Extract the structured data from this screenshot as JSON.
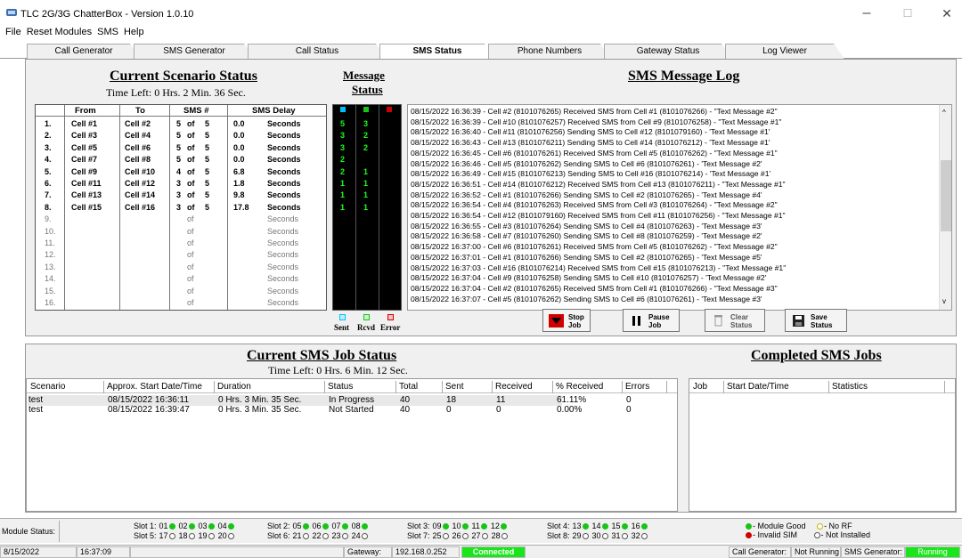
{
  "window": {
    "title": "TLC 2G/3G ChatterBox - Version 1.0.10",
    "min": "–",
    "max": "☐",
    "close": "✕"
  },
  "menu": [
    "File",
    "Reset Modules",
    "SMS",
    "Help"
  ],
  "tabs": [
    "Call Generator",
    "SMS Generator",
    "Call Status",
    "SMS Status",
    "Phone Numbers",
    "Gateway Status",
    "Log Viewer"
  ],
  "scenario": {
    "title": "Current Scenario Status",
    "time_left": "Time Left: 0 Hrs. 2 Min. 36 Sec.",
    "headers": [
      "From",
      "To",
      "SMS #",
      "SMS Delay"
    ],
    "rows": [
      {
        "n": "1.",
        "from": "Cell #1",
        "to": "Cell #2",
        "a": "5",
        "of": "of",
        "b": "5",
        "delay": "0.0",
        "unit": "Seconds"
      },
      {
        "n": "2.",
        "from": "Cell #3",
        "to": "Cell #4",
        "a": "5",
        "of": "of",
        "b": "5",
        "delay": "0.0",
        "unit": "Seconds"
      },
      {
        "n": "3.",
        "from": "Cell #5",
        "to": "Cell #6",
        "a": "5",
        "of": "of",
        "b": "5",
        "delay": "0.0",
        "unit": "Seconds"
      },
      {
        "n": "4.",
        "from": "Cell #7",
        "to": "Cell #8",
        "a": "5",
        "of": "of",
        "b": "5",
        "delay": "0.0",
        "unit": "Seconds"
      },
      {
        "n": "5.",
        "from": "Cell #9",
        "to": "Cell #10",
        "a": "4",
        "of": "of",
        "b": "5",
        "delay": "6.8",
        "unit": "Seconds"
      },
      {
        "n": "6.",
        "from": "Cell #11",
        "to": "Cell #12",
        "a": "3",
        "of": "of",
        "b": "5",
        "delay": "1.8",
        "unit": "Seconds"
      },
      {
        "n": "7.",
        "from": "Cell #13",
        "to": "Cell #14",
        "a": "3",
        "of": "of",
        "b": "5",
        "delay": "9.8",
        "unit": "Seconds"
      },
      {
        "n": "8.",
        "from": "Cell #15",
        "to": "Cell #16",
        "a": "3",
        "of": "of",
        "b": "5",
        "delay": "17.8",
        "unit": "Seconds"
      },
      {
        "n": "9.",
        "from": "",
        "to": "",
        "a": "",
        "of": "of",
        "b": "",
        "delay": "",
        "unit": "Seconds"
      },
      {
        "n": "10.",
        "from": "",
        "to": "",
        "a": "",
        "of": "of",
        "b": "",
        "delay": "",
        "unit": "Seconds"
      },
      {
        "n": "11.",
        "from": "",
        "to": "",
        "a": "",
        "of": "of",
        "b": "",
        "delay": "",
        "unit": "Seconds"
      },
      {
        "n": "12.",
        "from": "",
        "to": "",
        "a": "",
        "of": "of",
        "b": "",
        "delay": "",
        "unit": "Seconds"
      },
      {
        "n": "13.",
        "from": "",
        "to": "",
        "a": "",
        "of": "of",
        "b": "",
        "delay": "",
        "unit": "Seconds"
      },
      {
        "n": "14.",
        "from": "",
        "to": "",
        "a": "",
        "of": "of",
        "b": "",
        "delay": "",
        "unit": "Seconds"
      },
      {
        "n": "15.",
        "from": "",
        "to": "",
        "a": "",
        "of": "of",
        "b": "",
        "delay": "",
        "unit": "Seconds"
      },
      {
        "n": "16.",
        "from": "",
        "to": "",
        "a": "",
        "of": "of",
        "b": "",
        "delay": "",
        "unit": "Seconds"
      }
    ]
  },
  "message_status": {
    "title_1": "Message",
    "title_2": "Status",
    "rows": [
      [
        "5",
        "3"
      ],
      [
        "3",
        "2"
      ],
      [
        "3",
        "2"
      ],
      [
        "2",
        ""
      ],
      [
        "2",
        "1"
      ],
      [
        "1",
        "1"
      ],
      [
        "1",
        "1"
      ],
      [
        "1",
        "1"
      ]
    ],
    "legend": [
      "Sent",
      "Rcvd",
      "Error"
    ],
    "colors": {
      "sent": "#00bfff",
      "rcvd": "#19c419",
      "error": "#d10000"
    }
  },
  "log": {
    "title": "SMS Message Log",
    "lines": [
      "08/15/2022 16:36:39 - Cell #2 (8101076265) Received SMS from Cell #1 (8101076266) - \"Text Message #2\"",
      "08/15/2022 16:36:39 - Cell #10 (8101076257) Received SMS from Cell #9 (8101076258) - \"Text Message #1\"",
      "08/15/2022 16:36:40 - Cell #11 (8101076256) Sending SMS to Cell #12 (8101079160) - 'Text Message #1'",
      "08/15/2022 16:36:43 - Cell #13 (8101076211) Sending SMS to Cell #14 (8101076212) - 'Text Message #1'",
      "08/15/2022 16:36:45 - Cell #6 (8101076261) Received SMS from Cell #5 (8101076262) - \"Text Message #1\"",
      "08/15/2022 16:36:46 - Cell #5 (8101076262) Sending SMS to Cell #6 (8101076261) - 'Text Message #2'",
      "08/15/2022 16:36:49 - Cell #15 (8101076213) Sending SMS to Cell #16 (8101076214) - 'Text Message #1'",
      "08/15/2022 16:36:51 - Cell #14 (8101076212) Received SMS from Cell #13 (8101076211) - \"Text Message #1\"",
      "08/15/2022 16:36:52 - Cell #1 (8101076266) Sending SMS to Cell #2 (8101076265) - 'Text Message #4'",
      "08/15/2022 16:36:54 - Cell #4 (8101076263) Received SMS from Cell #3 (8101076264) - \"Text Message #2\"",
      "08/15/2022 16:36:54 - Cell #12 (8101079160) Received SMS from Cell #11 (8101076256) - \"Text Message #1\"",
      "08/15/2022 16:36:55 - Cell #3 (8101076264) Sending SMS to Cell #4 (8101076263) - 'Text Message #3'",
      "08/15/2022 16:36:58 - Cell #7 (8101076260) Sending SMS to Cell #8 (8101076259) - 'Text Message #2'",
      "08/15/2022 16:37:00 - Cell #6 (8101076261) Received SMS from Cell #5 (8101076262) - \"Text Message #2\"",
      "08/15/2022 16:37:01 - Cell #1 (8101076266) Sending SMS to Cell #2 (8101076265) - 'Text Message #5'",
      "08/15/2022 16:37:03 - Cell #16 (8101076214) Received SMS from Cell #15 (8101076213) - \"Text Message #1\"",
      "08/15/2022 16:37:04 - Cell #9 (8101076258) Sending SMS to Cell #10 (8101076257) - 'Text Message #2'",
      "08/15/2022 16:37:04 - Cell #2 (8101076265) Received SMS from Cell #1 (8101076266) - \"Text Message #3\"",
      "08/15/2022 16:37:07 - Cell #5 (8101076262) Sending SMS to Cell #6 (8101076261) - 'Text Message #3'"
    ]
  },
  "buttons": {
    "stop": "Stop",
    "pause": "Pause",
    "clear": "Clear",
    "save": "Save",
    "job": "Job",
    "status": "Status"
  },
  "job_status": {
    "title": "Current SMS Job Status",
    "time_left": "Time Left: 0 Hrs. 6 Min. 12 Sec.",
    "headers": [
      "Scenario",
      "Approx. Start Date/Time",
      "Duration",
      "Status",
      "Total",
      "Sent",
      "Received",
      "% Received",
      "Errors"
    ],
    "rows": [
      [
        "test",
        "08/15/2022 16:36:11",
        "0 Hrs. 3 Min. 35 Sec.",
        "In Progress",
        "40",
        "18",
        "11",
        "61.11%",
        "0"
      ],
      [
        "test",
        "08/15/2022 16:39:47",
        "0 Hrs. 3 Min. 35 Sec.",
        "Not Started",
        "40",
        "0",
        "0",
        "0.00%",
        "0"
      ]
    ]
  },
  "completed": {
    "title": "Completed SMS Jobs",
    "headers": [
      "Job",
      "Start Date/Time",
      "Statistics"
    ]
  },
  "module_status": {
    "label": "Module Status:",
    "slots": [
      {
        "name": "Slot 1:",
        "mods": [
          "01",
          "02",
          "03",
          "04"
        ],
        "state": "good"
      },
      {
        "name": "Slot 5:",
        "mods": [
          "17",
          "18",
          "19",
          "20"
        ],
        "state": "none"
      },
      {
        "name": "Slot 2:",
        "mods": [
          "05",
          "06",
          "07",
          "08"
        ],
        "state": "good"
      },
      {
        "name": "Slot 6:",
        "mods": [
          "21",
          "22",
          "23",
          "24"
        ],
        "state": "none"
      },
      {
        "name": "Slot 3:",
        "mods": [
          "09",
          "10",
          "11",
          "12"
        ],
        "state": "good"
      },
      {
        "name": "Slot 7:",
        "mods": [
          "25",
          "26",
          "27",
          "28"
        ],
        "state": "none"
      },
      {
        "name": "Slot 4:",
        "mods": [
          "13",
          "14",
          "15",
          "16"
        ],
        "state": "good"
      },
      {
        "name": "Slot 8:",
        "mods": [
          "29",
          "30",
          "31",
          "32"
        ],
        "state": "none"
      }
    ],
    "legend": [
      "- Module Good",
      "- No RF",
      "- Invalid SIM",
      "- Not Installed"
    ]
  },
  "statusbar": {
    "date": "8/15/2022",
    "time": "16:37:09",
    "gateway_label": "Gateway:",
    "gateway_ip": "192.168.0.252",
    "connected": "Connected",
    "callgen": "Call Generator:",
    "callgen_state": "Not Running",
    "smsgen": "SMS Generator:",
    "smsgen_state": "Running"
  }
}
